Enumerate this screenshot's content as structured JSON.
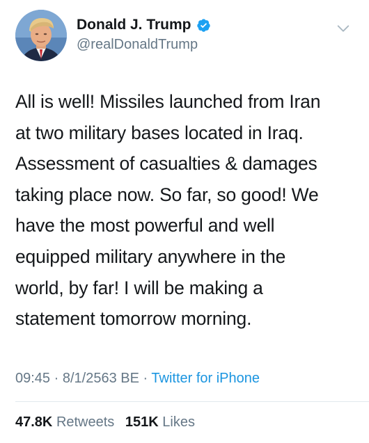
{
  "user": {
    "display_name": "Donald J. Trump",
    "handle": "@realDonaldTrump",
    "verified": true,
    "avatar_icon": "profile-photo-avatar",
    "verified_icon": "verified-badge-icon"
  },
  "tweet": {
    "text_lines": [
      "All is well! Missiles launched from Iran",
      "at two military bases located in Iraq.",
      "Assessment of casualties & damages",
      "taking place now. So far, so good! We",
      "have the most powerful and well",
      "equipped military anywhere in the",
      "world, by far! I will be making a",
      "statement tomorrow morning."
    ]
  },
  "meta": {
    "time": "09:45",
    "separator": "·",
    "date": "8/1/2563 BE",
    "source": "Twitter for iPhone"
  },
  "stats": {
    "retweets_count": "47.8K",
    "retweets_label": "Retweets",
    "likes_count": "151K",
    "likes_label": "Likes"
  },
  "menu": {
    "icon": "chevron-down-icon"
  },
  "colors": {
    "text_primary": "#14171a",
    "text_secondary": "#657786",
    "link": "#1b95e0",
    "verified_badge": "#1da1f2",
    "divider": "#e1e8ed"
  }
}
